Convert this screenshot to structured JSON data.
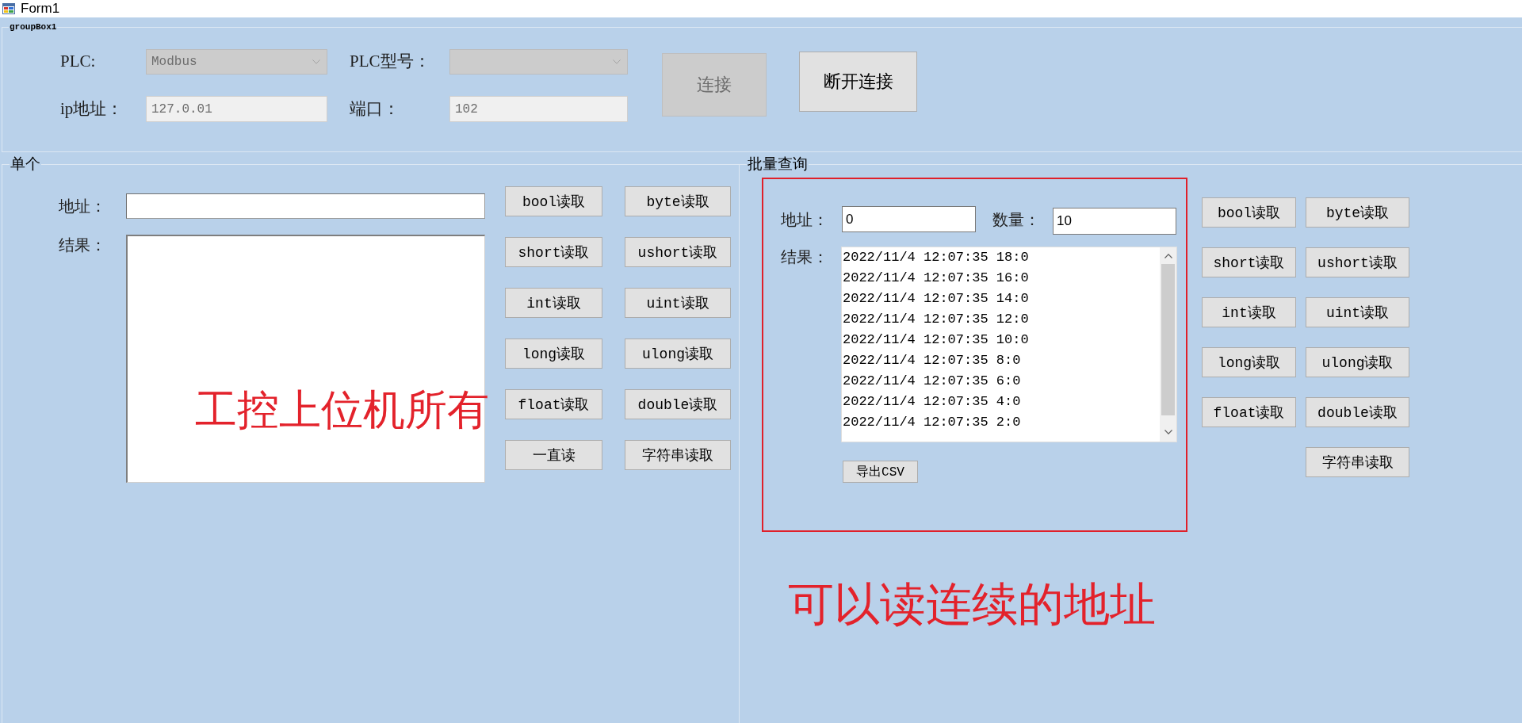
{
  "window": {
    "title": "Form1"
  },
  "connection": {
    "title": "groupBox1",
    "fields": [
      {
        "kind": "combo",
        "label": "PLC:",
        "value": "Modbus",
        "disabled": true
      },
      {
        "kind": "combo",
        "label": "PLC型号：",
        "disabled": true
      },
      {
        "kind": "text",
        "label": "ip地址：",
        "value": "127.0.01",
        "disabled": true
      },
      {
        "kind": "text",
        "label": "端口：",
        "value": "102",
        "disabled": true
      }
    ],
    "buttons": [
      {
        "label": "连接",
        "disabled": true
      },
      {
        "label": "断开连接",
        "disabled": false
      }
    ]
  },
  "single": {
    "title": "单个",
    "address": {
      "label": "地址："
    },
    "result": {
      "label": "结果："
    },
    "buttons": [
      "bool读取",
      "byte读取",
      "short读取",
      "ushort读取",
      "int读取",
      "uint读取",
      "long读取",
      "ulong读取",
      "float读取",
      "double读取",
      "一直读",
      "字符串读取"
    ],
    "annotation": "工控上位机所有"
  },
  "batch": {
    "title": "批量查询",
    "address": {
      "label": "地址：",
      "value": "0"
    },
    "count": {
      "label": "数量：",
      "value": "10"
    },
    "result": {
      "label": "结果：",
      "lines": [
        "2022/11/4 12:07:35 18:0",
        "2022/11/4 12:07:35 16:0",
        "2022/11/4 12:07:35 14:0",
        "2022/11/4 12:07:35 12:0",
        "2022/11/4 12:07:35 10:0",
        "2022/11/4 12:07:35 8:0",
        "2022/11/4 12:07:35 6:0",
        "2022/11/4 12:07:35 4:0",
        "2022/11/4 12:07:35 2:0"
      ]
    },
    "export_button": "导出CSV",
    "buttons": [
      "bool读取",
      "byte读取",
      "short读取",
      "ushort读取",
      "int读取",
      "uint读取",
      "long读取",
      "ulong读取",
      "float读取",
      "double读取",
      "字符串读取"
    ],
    "annotation": "可以读连续的地址"
  }
}
